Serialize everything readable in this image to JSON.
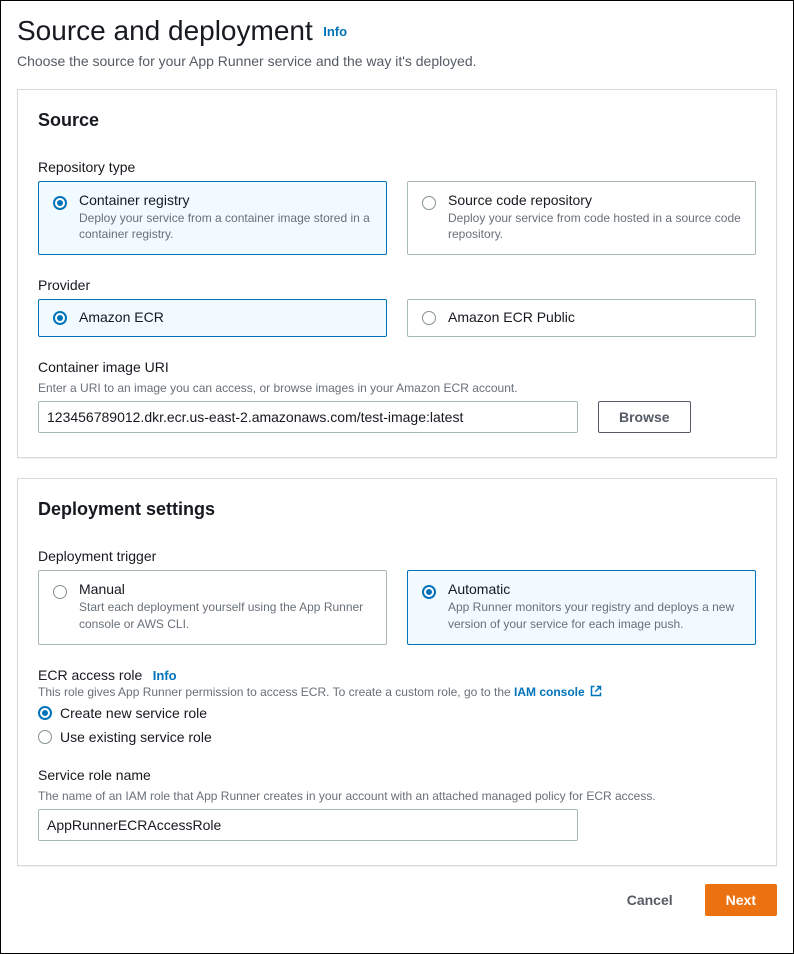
{
  "header": {
    "title": "Source and deployment",
    "info": "Info",
    "description": "Choose the source for your App Runner service and the way it's deployed."
  },
  "source": {
    "title": "Source",
    "repository_type_label": "Repository type",
    "options": {
      "container": {
        "title": "Container registry",
        "desc": "Deploy your service from a container image stored in a container registry."
      },
      "code": {
        "title": "Source code repository",
        "desc": "Deploy your service from code hosted in a source code repository."
      }
    },
    "provider_label": "Provider",
    "providers": {
      "ecr": "Amazon ECR",
      "ecr_public": "Amazon ECR Public"
    },
    "uri_label": "Container image URI",
    "uri_hint": "Enter a URI to an image you can access, or browse images in your Amazon ECR account.",
    "uri_value": "123456789012.dkr.ecr.us-east-2.amazonaws.com/test-image:latest",
    "browse_label": "Browse"
  },
  "deployment": {
    "title": "Deployment settings",
    "trigger_label": "Deployment trigger",
    "manual": {
      "title": "Manual",
      "desc": "Start each deployment yourself using the App Runner console or AWS CLI."
    },
    "automatic": {
      "title": "Automatic",
      "desc": "App Runner monitors your registry and deploys a new version of your service for each image push."
    },
    "ecr_role_label": "ECR access role",
    "ecr_role_info": "Info",
    "ecr_role_hint_prefix": "This role gives App Runner permission to access ECR. To create a custom role, go to the ",
    "iam_console_link": "IAM console",
    "role_options": {
      "create": "Create new service role",
      "existing": "Use existing service role"
    },
    "service_role_name_label": "Service role name",
    "service_role_name_hint": "The name of an IAM role that App Runner creates in your account with an attached managed policy for ECR access.",
    "service_role_name_value": "AppRunnerECRAccessRole"
  },
  "footer": {
    "cancel": "Cancel",
    "next": "Next"
  }
}
